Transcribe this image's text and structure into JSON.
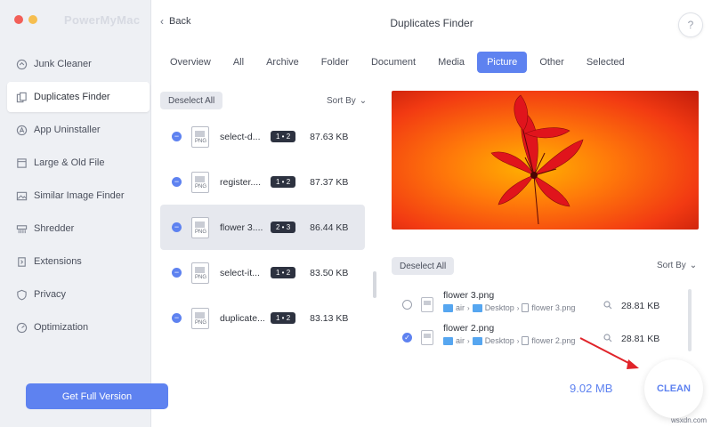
{
  "app": {
    "brand": "PowerMyMac"
  },
  "header": {
    "back_label": "Back",
    "title": "Duplicates Finder",
    "help_label": "?"
  },
  "sidebar": {
    "items": [
      {
        "label": "Junk Cleaner",
        "icon": "broom-icon"
      },
      {
        "label": "Duplicates Finder",
        "icon": "duplicate-icon",
        "active": true
      },
      {
        "label": "App Uninstaller",
        "icon": "app-icon"
      },
      {
        "label": "Large & Old File",
        "icon": "file-icon"
      },
      {
        "label": "Similar Image Finder",
        "icon": "image-icon"
      },
      {
        "label": "Shredder",
        "icon": "shredder-icon"
      },
      {
        "label": "Extensions",
        "icon": "extensions-icon"
      },
      {
        "label": "Privacy",
        "icon": "shield-icon"
      },
      {
        "label": "Optimization",
        "icon": "optimization-icon"
      }
    ],
    "get_full_label": "Get Full Version"
  },
  "tabs": [
    {
      "label": "Overview"
    },
    {
      "label": "All"
    },
    {
      "label": "Archive"
    },
    {
      "label": "Folder"
    },
    {
      "label": "Document"
    },
    {
      "label": "Media"
    },
    {
      "label": "Picture",
      "active": true
    },
    {
      "label": "Other"
    },
    {
      "label": "Selected"
    }
  ],
  "left_list": {
    "deselect_label": "Deselect All",
    "sort_label": "Sort By",
    "file_type": "PNG",
    "rows": [
      {
        "name": "select-d...",
        "badge": "1 • 2",
        "size": "87.63 KB"
      },
      {
        "name": "register....",
        "badge": "1 • 2",
        "size": "87.37 KB"
      },
      {
        "name": "flower 3....",
        "badge": "2 • 3",
        "size": "86.44 KB",
        "active": true
      },
      {
        "name": "select-it...",
        "badge": "1 • 2",
        "size": "83.50 KB"
      },
      {
        "name": "duplicate...",
        "badge": "1 • 2",
        "size": "83.13 KB"
      }
    ]
  },
  "right_list": {
    "deselect_label": "Deselect All",
    "sort_label": "Sort By",
    "rows": [
      {
        "name": "flower 3.png",
        "path": [
          "air",
          "Desktop",
          "flower 3.png"
        ],
        "size": "28.81 KB",
        "checked": false
      },
      {
        "name": "flower 2.png",
        "path": [
          "air",
          "Desktop",
          "flower 2.png"
        ],
        "size": "28.81 KB",
        "checked": true
      }
    ]
  },
  "footer": {
    "total": "9.02 MB",
    "clean_label": "CLEAN"
  },
  "watermark": "wsxdn.com",
  "colors": {
    "accent": "#5e82f0",
    "preview_bg": "#f24b14",
    "arrow": "#e0242a"
  }
}
